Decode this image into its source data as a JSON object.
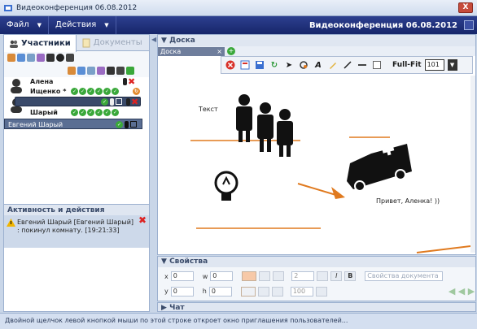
{
  "window": {
    "title": "Видеоконференция 06.08.2012",
    "close_label": "X"
  },
  "menubar": {
    "items": [
      {
        "label": "Файл"
      },
      {
        "label": "Действия"
      }
    ],
    "conference_title": "Видеоконференция 06.08.2012"
  },
  "left_panel": {
    "tabs": [
      {
        "label": "Участники"
      },
      {
        "label": "Документы"
      }
    ],
    "participants": [
      {
        "name": "Алена"
      },
      {
        "name": "Ищенко *"
      },
      {
        "name": "Шарый"
      }
    ],
    "selected_participant": "Евгений Шарый"
  },
  "activity": {
    "header": "Активность и действия",
    "items": [
      {
        "text": "Евгений Шарый [Евгений Шарый] : покинул комнату. [19:21:33]"
      }
    ]
  },
  "board": {
    "header": "Доска",
    "doc_tab": "Доска",
    "fullfit_label": "Full-Fit",
    "zoom_value": "101",
    "canvas_text": [
      {
        "text": "Текст"
      },
      {
        "text": "Привет, Аленка! ))"
      }
    ]
  },
  "properties": {
    "header": "Свойства",
    "x_label": "x",
    "x_value": "0",
    "y_label": "y",
    "y_value": "0",
    "w_label": "w",
    "w_value": "0",
    "h_label": "h",
    "h_value": "0",
    "stroke_value": "2",
    "opacity_value": "100",
    "doc_props_placeholder": "Свойства документа"
  },
  "chat": {
    "header": "Чат"
  },
  "status_bar": {
    "text": "Двойной щелчок левой кнопкой мыши по этой строке откроет окно приглашения пользователей..."
  }
}
